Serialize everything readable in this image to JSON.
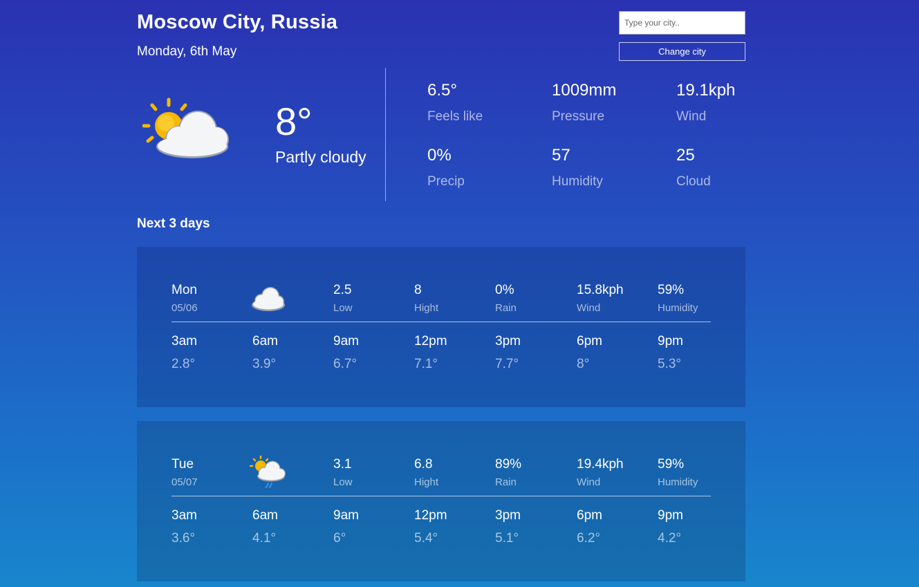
{
  "location": {
    "city": "Moscow City, Russia",
    "date": "Monday, 6th May"
  },
  "search": {
    "placeholder": "Type your city..",
    "value": "",
    "button_label": "Change city"
  },
  "current": {
    "icon": "partly-cloudy-sun-icon",
    "temp": "8°",
    "condition": "Partly cloudy",
    "stats": [
      {
        "value": "6.5°",
        "label": "Feels like"
      },
      {
        "value": "1009mm",
        "label": "Pressure"
      },
      {
        "value": "19.1kph",
        "label": "Wind"
      },
      {
        "value": "0%",
        "label": "Precip"
      },
      {
        "value": "57",
        "label": "Humidity"
      },
      {
        "value": "25",
        "label": "Cloud"
      }
    ]
  },
  "forecast": {
    "title": "Next 3 days",
    "days": [
      {
        "day": "Mon",
        "date": "05/06",
        "icon": "cloud-icon",
        "low": "2.5",
        "low_label": "Low",
        "high": "8",
        "high_label": "Hight",
        "rain": "0%",
        "rain_label": "Rain",
        "wind": "15.8kph",
        "wind_label": "Wind",
        "humidity": "59%",
        "humidity_label": "Humidity",
        "hours": [
          {
            "time": "3am",
            "temp": "2.8°"
          },
          {
            "time": "6am",
            "temp": "3.9°"
          },
          {
            "time": "9am",
            "temp": "6.7°"
          },
          {
            "time": "12pm",
            "temp": "7.1°"
          },
          {
            "time": "3pm",
            "temp": "7.7°"
          },
          {
            "time": "6pm",
            "temp": "8°"
          },
          {
            "time": "9pm",
            "temp": "5.3°"
          }
        ]
      },
      {
        "day": "Tue",
        "date": "05/07",
        "icon": "sun-cloud-rain-icon",
        "low": "3.1",
        "low_label": "Low",
        "high": "6.8",
        "high_label": "Hight",
        "rain": "89%",
        "rain_label": "Rain",
        "wind": "19.4kph",
        "wind_label": "Wind",
        "humidity": "59%",
        "humidity_label": "Humidity",
        "hours": [
          {
            "time": "3am",
            "temp": "3.6°"
          },
          {
            "time": "6am",
            "temp": "4.1°"
          },
          {
            "time": "9am",
            "temp": "6°"
          },
          {
            "time": "12pm",
            "temp": "5.4°"
          },
          {
            "time": "3pm",
            "temp": "5.1°"
          },
          {
            "time": "6pm",
            "temp": "6.2°"
          },
          {
            "time": "9pm",
            "temp": "4.2°"
          }
        ]
      }
    ]
  },
  "colors": {
    "bg_top": "#2a32b2",
    "bg_bottom": "#1886cc",
    "sun": "#f6b800",
    "cloud": "#f2f4f7"
  }
}
